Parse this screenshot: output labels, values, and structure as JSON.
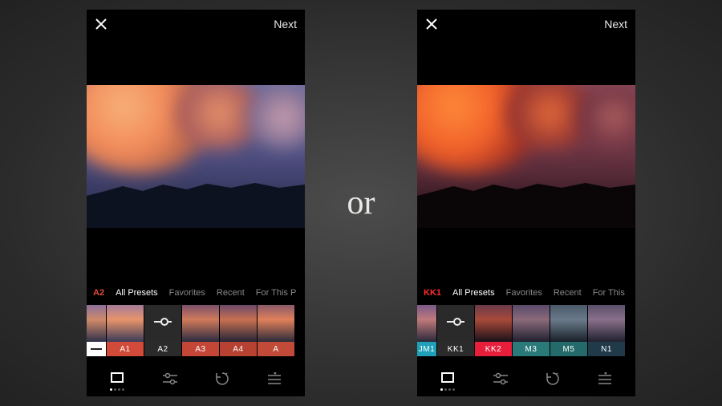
{
  "divider_label": "or",
  "left": {
    "header": {
      "next": "Next"
    },
    "current_preset": "A2",
    "tabs": [
      "All Presets",
      "Favorites",
      "Recent",
      "For This P"
    ],
    "active_tab": "All Presets",
    "presets": [
      {
        "id": "none",
        "label": "",
        "color": "#ffffff"
      },
      {
        "id": "a1",
        "label": "A1",
        "color": "#d24a3a"
      },
      {
        "id": "a2",
        "label": "A2",
        "color": "#2b2b2b",
        "selected": true
      },
      {
        "id": "a3",
        "label": "A3",
        "color": "#c44636"
      },
      {
        "id": "a4",
        "label": "A4",
        "color": "#b84232"
      },
      {
        "id": "a5",
        "label": "A",
        "color": "#c24a38"
      }
    ]
  },
  "right": {
    "header": {
      "next": "Next"
    },
    "current_preset": "KK1",
    "tabs": [
      "All Presets",
      "Favorites",
      "Recent",
      "For This"
    ],
    "active_tab": "All Presets",
    "presets": [
      {
        "id": "jm1",
        "label": "JM1",
        "color": "#1fa0b8"
      },
      {
        "id": "kk1",
        "label": "KK1",
        "color": "#2b2b2b",
        "selected": true
      },
      {
        "id": "kk2",
        "label": "KK2",
        "color": "#e81e3a"
      },
      {
        "id": "m3",
        "label": "M3",
        "color": "#2a7a7a"
      },
      {
        "id": "m5",
        "label": "M5",
        "color": "#246a6a"
      },
      {
        "id": "n1",
        "label": "N1",
        "color": "#203a4a"
      }
    ]
  },
  "nav_icons": [
    "presets",
    "adjust",
    "history",
    "organize"
  ]
}
